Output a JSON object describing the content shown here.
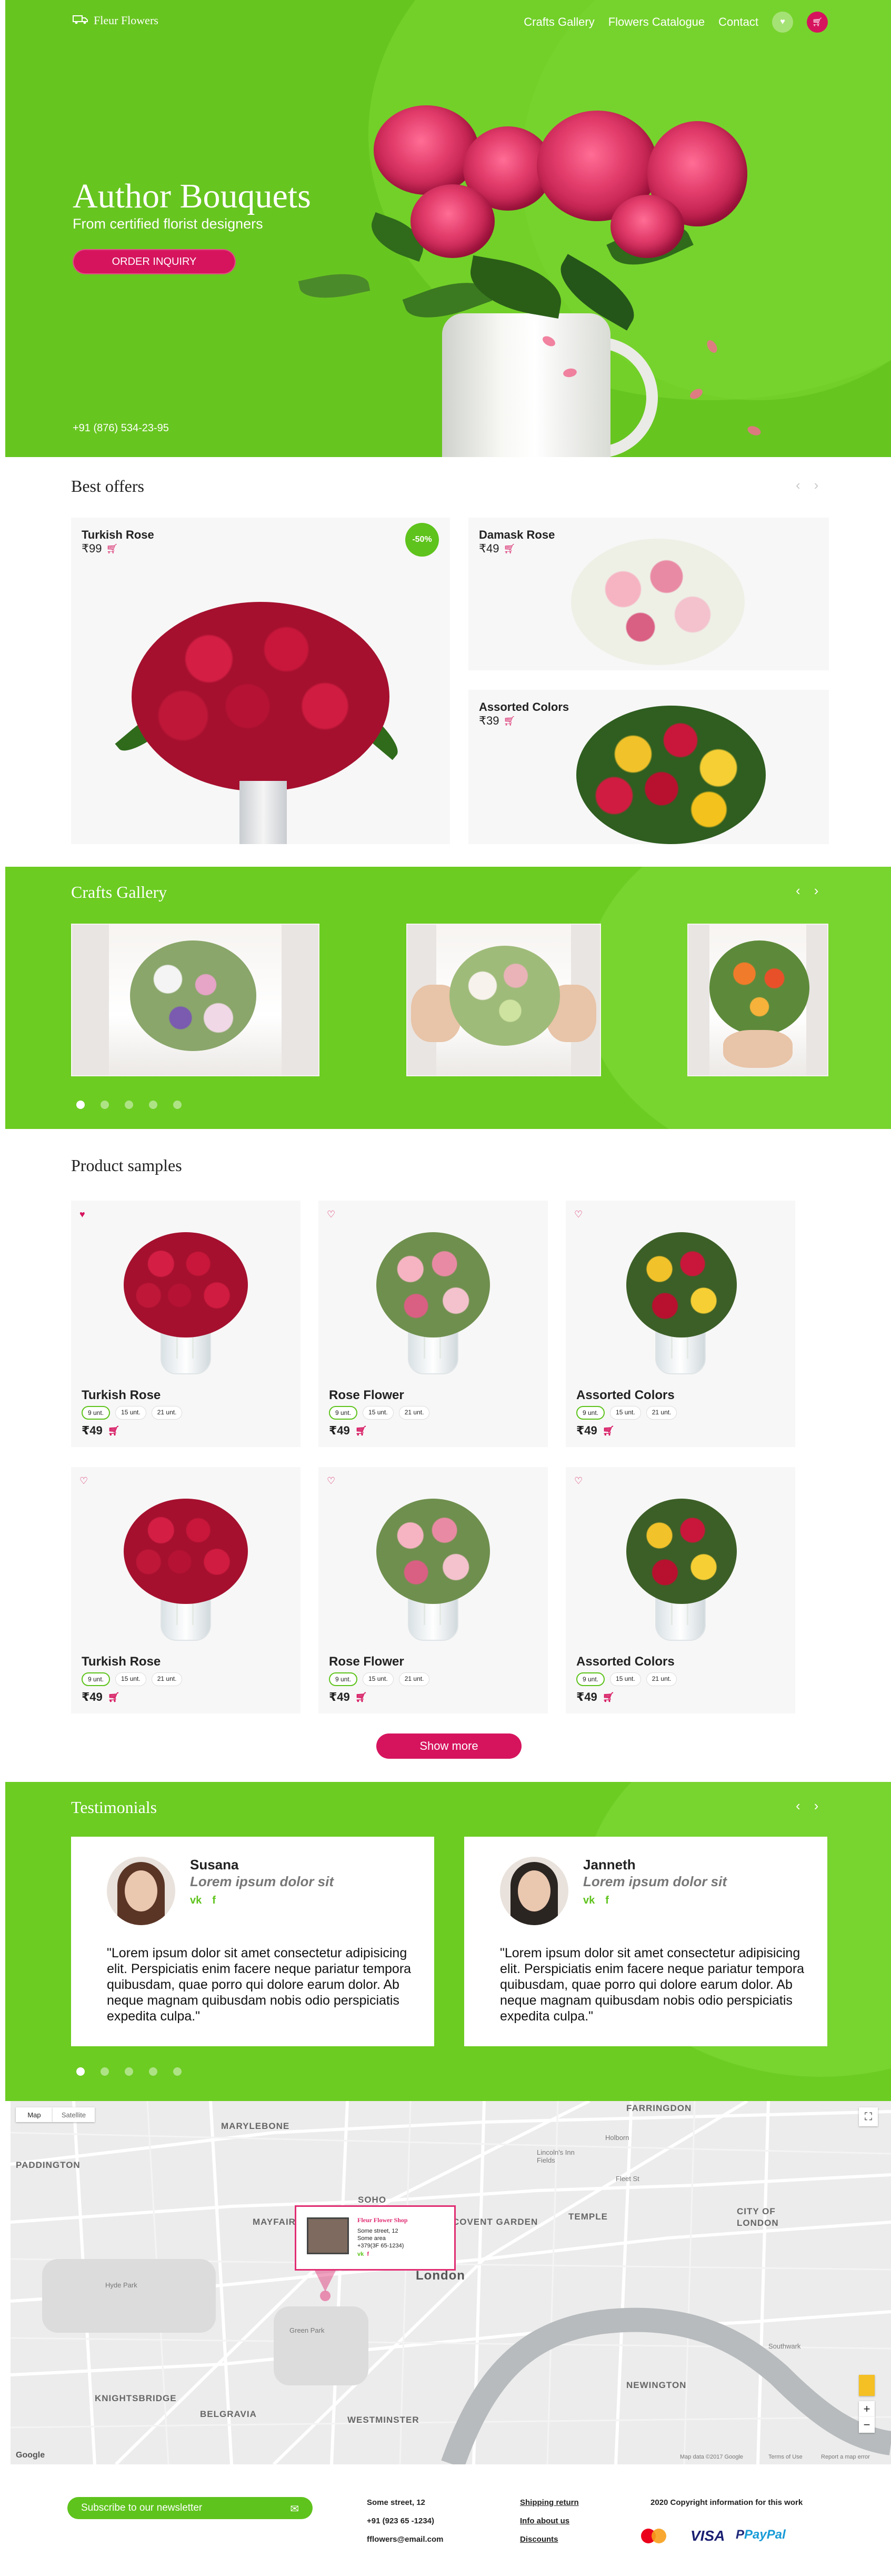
{
  "header": {
    "logo_text": "Fleur Flowers",
    "nav": [
      "Crafts Gallery",
      "Flowers Catalogue",
      "Contact"
    ]
  },
  "hero": {
    "title": "Author Bouquets",
    "subtitle": "From certified florist designers",
    "cta": "ORDER INQUIRY",
    "phone": "+91 (876) 534-23-95"
  },
  "best_offers": {
    "title": "Best offers",
    "items": [
      {
        "name": "Turkish Rose",
        "price": "₹99",
        "badge": "-50%"
      },
      {
        "name": "Damask Rose",
        "price": "₹49"
      },
      {
        "name": "Assorted Colors",
        "price": "₹39"
      }
    ]
  },
  "gallery": {
    "title": "Crafts Gallery",
    "dots": 5
  },
  "products": {
    "title": "Product samples",
    "qty_options": [
      "9 unt.",
      "15 unt.",
      "21 unt."
    ],
    "items": [
      {
        "name": "Turkish Rose",
        "price": "₹49",
        "favorite": true
      },
      {
        "name": "Rose Flower",
        "price": "₹49",
        "favorite": false
      },
      {
        "name": "Assorted Colors",
        "price": "₹49",
        "favorite": false
      },
      {
        "name": "Turkish Rose",
        "price": "₹49",
        "favorite": false
      },
      {
        "name": "Rose Flower",
        "price": "₹49",
        "favorite": false
      },
      {
        "name": "Assorted Colors",
        "price": "₹49",
        "favorite": false
      }
    ],
    "show_more": "Show more"
  },
  "testimonials": {
    "title": "Testimonials",
    "items": [
      {
        "name": "Susana",
        "subtitle": "Lorem ipsum dolor sit",
        "quote": "\"Lorem ipsum dolor sit amet consectetur adipisicing elit. Perspiciatis enim facere neque pariatur tempora quibusdam, quae porro qui dolore earum dolor. Ab neque magnam quibusdam nobis odio perspiciatis expedita culpa.\""
      },
      {
        "name": "Janneth",
        "subtitle": "Lorem ipsum dolor sit",
        "quote": "\"Lorem ipsum dolor sit amet consectetur adipisicing elit. Perspiciatis enim facere neque pariatur tempora quibusdam, quae porro qui dolore earum dolor. Ab neque magnam quibusdam nobis odio perspiciatis expedita culpa.\""
      }
    ],
    "social": [
      "vk",
      "f"
    ]
  },
  "map": {
    "tabs": [
      "Map",
      "Satellite"
    ],
    "popup": {
      "title": "Fleur Flower Shop",
      "line1": "Some street, 12",
      "line2": "Some area",
      "line3": "+379(3F 65-1234)"
    },
    "labels": {
      "marylebone": "MARYLEBONE",
      "paddington": "PADDINGTON",
      "soho": "SOHO",
      "mayfair": "MAYFAIR",
      "covent": "COVENT GARDEN",
      "temple": "TEMPLE",
      "city1": "CITY OF",
      "city2": "LONDON",
      "london": "London",
      "knightsbridge": "KNIGHTSBRIDGE",
      "belgravia": "BELGRAVIA",
      "westminster": "WESTMINSTER",
      "newington": "NEWINGTON",
      "farringdon": "FARRINGDON",
      "hyde_park": "Hyde Park",
      "green_park": "Green Park",
      "holborn": "Holborn",
      "fleet": "Fleet St",
      "southwark": "Southwark",
      "lincoln": "Lincoln's Inn Fields"
    },
    "attribution": "Map data ©2017 Google",
    "terms": "Terms of Use",
    "report": "Report a map error",
    "google": "Google"
  },
  "footer": {
    "newsletter": "Subscribe to our newsletter",
    "address": "Some street, 12",
    "phone": "+91 (923 65 -1234)",
    "email": "fflowers@email.com",
    "links": [
      "Shipping return",
      "Info about us",
      "Discounts"
    ],
    "copyright": "2020 Copyright information for this work",
    "payments": [
      "VISA",
      "PayPal"
    ]
  },
  "colors": {
    "green": "#67c520",
    "pink": "#d6145e"
  }
}
